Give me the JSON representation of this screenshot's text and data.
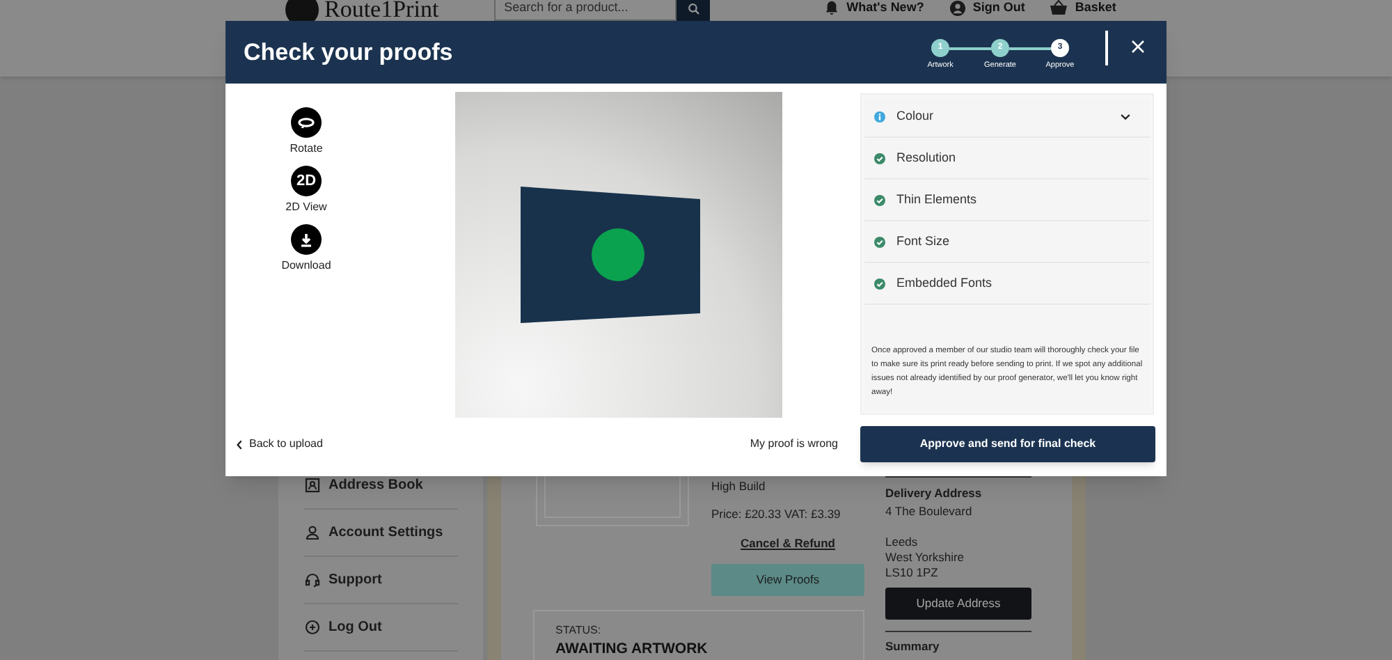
{
  "header": {
    "logo": "Route1Print",
    "search": {
      "placeholder": "Search for a product..."
    },
    "links": [
      {
        "kind": "bell",
        "label": "What's New?"
      },
      {
        "kind": "user",
        "label": "Sign Out"
      },
      {
        "kind": "basket",
        "label": "Basket"
      }
    ]
  },
  "sidebar": {
    "items": [
      {
        "kind": "address",
        "label": "Address Book"
      },
      {
        "kind": "user",
        "label": "Account Settings"
      },
      {
        "kind": "headset",
        "label": "Support"
      },
      {
        "kind": "logout",
        "label": "Log Out"
      }
    ]
  },
  "order": {
    "product_line": "High Build",
    "price": "Price: £20.33 VAT: £3.39",
    "cancel_link": "Cancel & Refund",
    "view_button": "View Proofs",
    "status_label": "STATUS:",
    "status": "AWAITING ARTWORK"
  },
  "delivery": {
    "heading": "Delivery Address",
    "street": "4 The Boulevard",
    "locality": [
      "Leeds",
      "West Yorkshire",
      "LS10 1PZ"
    ],
    "button": "Update Address",
    "summary": "Summary"
  },
  "modal": {
    "title": "Check your proofs",
    "steps": [
      {
        "number": "1",
        "label": "Artwork",
        "completed": true
      },
      {
        "number": "2",
        "label": "Generate",
        "completed": true
      },
      {
        "number": "3",
        "label": "Approve",
        "completed": false
      }
    ],
    "tools": [
      {
        "kind": "rotate",
        "label": "Rotate"
      },
      {
        "kind": "flat",
        "icon_text": "2D",
        "label": "2D View"
      },
      {
        "kind": "download",
        "label": "Download"
      }
    ],
    "checks": [
      {
        "label": "Colour",
        "kind": "info",
        "expandable": true
      },
      {
        "label": "Resolution",
        "kind": "pass",
        "expandable": false
      },
      {
        "label": "Thin Elements",
        "kind": "pass",
        "expandable": false
      },
      {
        "label": "Font Size",
        "kind": "pass",
        "expandable": false
      },
      {
        "label": "Embedded Fonts",
        "kind": "pass",
        "expandable": false
      }
    ],
    "note": "Once approved a member of our studio team will thoroughly check your file to make sure its print ready before sending to print. If we spot any additional issues not already identified by our proof generator, we'll let you know right away!",
    "back_link": "Back to upload",
    "wrong_link": "My proof is wrong",
    "approve_button": "Approve and send for final check"
  }
}
